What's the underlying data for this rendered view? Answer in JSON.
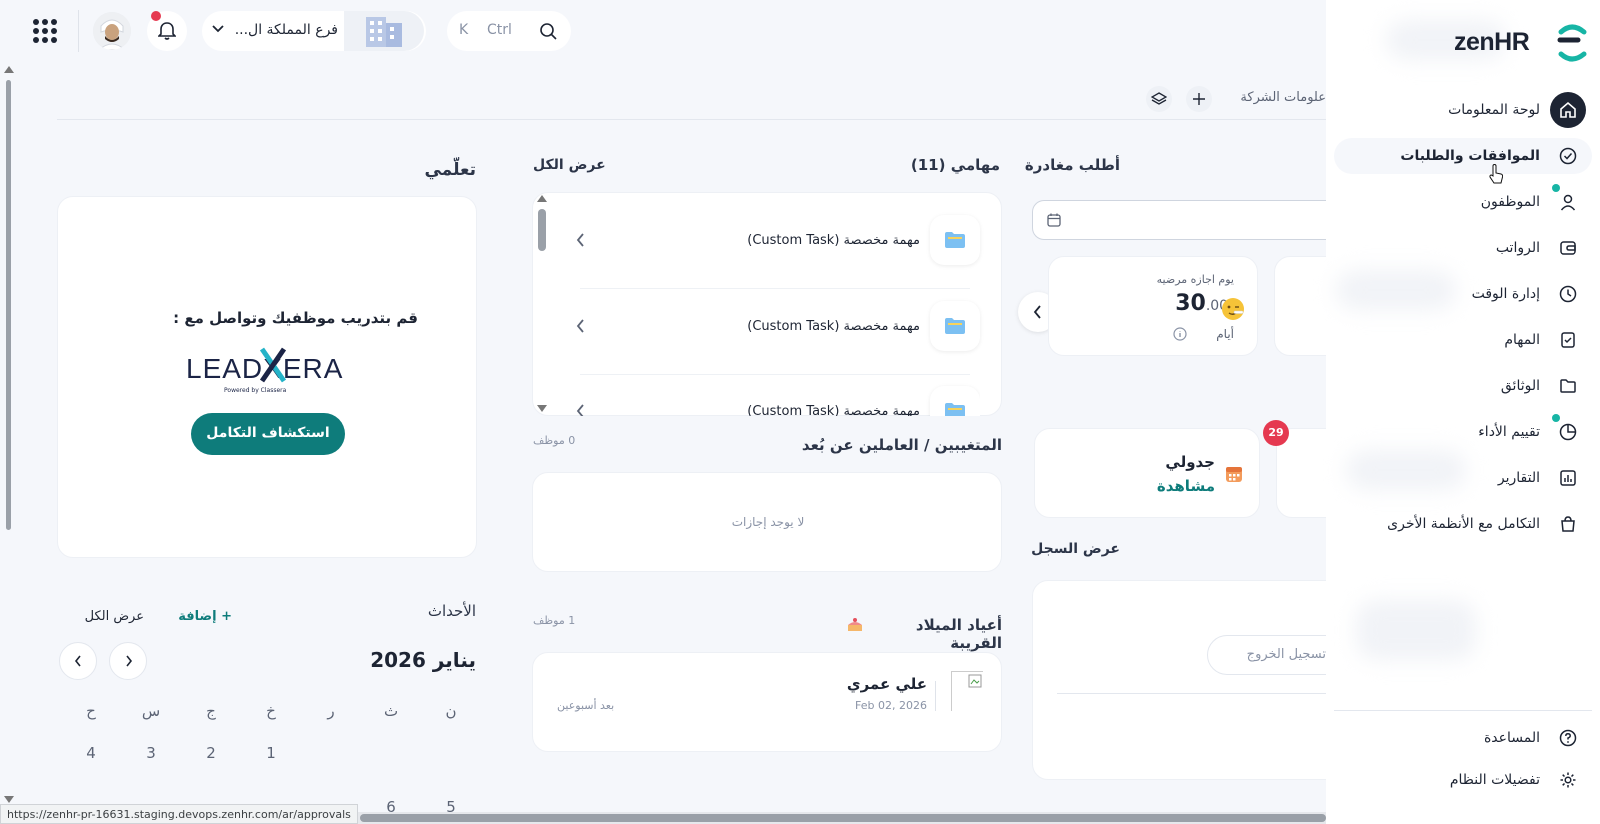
{
  "topbar": {
    "branch": "فرع المملكة ال...",
    "search_key_k": "K",
    "search_key_ctrl": "Ctrl"
  },
  "breadcrumb": {
    "label": "علومات الشركة"
  },
  "sidebar": {
    "logo": "zenHR",
    "items": [
      {
        "label": "لوحة المعلومات"
      },
      {
        "label": "الموافقات والطلبات"
      },
      {
        "label": "الموظفون"
      },
      {
        "label": "الرواتب"
      },
      {
        "label": "إدارة الوقت"
      },
      {
        "label": "المهام"
      },
      {
        "label": "الوثائق"
      },
      {
        "label": "تقييم الأداء"
      },
      {
        "label": "التقارير"
      },
      {
        "label": "التكامل مع الأنظمة الأخرى"
      }
    ],
    "help": "المساعدة",
    "settings": "تفضيلات النظام"
  },
  "leave": {
    "title": "أطلب مغادرة",
    "balance_label": "يوم اجازه مرضيه",
    "balance_int": "30",
    "balance_dec": ".000",
    "unit": "أيام"
  },
  "schedule": {
    "title": "جدولي",
    "action": "مشاهدة",
    "badge": "29"
  },
  "log": {
    "title": "عرض السجل",
    "checkout": "تسجيل الخروج"
  },
  "tasks": {
    "title": "مهامي (11)",
    "view_all": "عرض الكل",
    "items": [
      {
        "label": "مهمة مخصصة (Custom Task)"
      },
      {
        "label": "مهمة مخصصة (Custom Task)"
      },
      {
        "label": "مهمة مخصصة (Custom Task)"
      }
    ]
  },
  "absent": {
    "title": "المتغيبين / العاملين عن بُعد",
    "count": "0 موظف",
    "empty": "لا يوجد إجازات"
  },
  "birthdays": {
    "title": "أعياد الميلاد القريبة",
    "count": "1 موظف",
    "name": "علي عمري",
    "date": "Feb 02, 2026",
    "when": "بعد أسبوعين"
  },
  "learn": {
    "title": "تعلّمي",
    "text": "قم بتدريب موظفيك وتواصل مع :",
    "brand": "LEADXERA",
    "brand_sub": "Powered by Classera",
    "button": "استكشاف التكامل"
  },
  "events": {
    "title": "الأحداث",
    "add": "+ إضافة",
    "view_all": "عرض الكل",
    "month": "يناير 2026",
    "weekdays": [
      "ن",
      "ث",
      "ر",
      "خ",
      "ج",
      "س",
      "ح"
    ],
    "days": [
      "1",
      "2",
      "3",
      "4"
    ],
    "next_days": [
      "5",
      "6"
    ]
  },
  "status_url": "https://zenhr-pr-16631.staging.devops.zenhr.com/ar/approvals",
  "colors": {
    "accent": "#0e7c7b",
    "badge": "#e53950",
    "notify": "#e53950"
  }
}
